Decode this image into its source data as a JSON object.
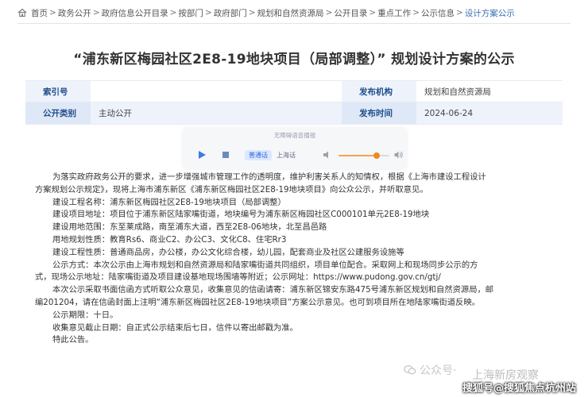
{
  "breadcrumb": {
    "items": [
      "首页",
      "政务公开",
      "政府信息公开目录",
      "按部门",
      "政府部门",
      "规划和自然资源局",
      "公开目录",
      "重点工作",
      "公示信息",
      "设计方案公示"
    ],
    "separator": ">"
  },
  "page_title": "“浦东新区梅园社区2E8-19地块项目（局部调整）” 规划设计方案的公示",
  "meta": {
    "index_label": "索引号",
    "index_value": "",
    "publisher_label": "发布机构",
    "publisher_value": "规划和自然资源局",
    "category_label": "公开类别",
    "category_value": "主动公开",
    "date_label": "发布时间",
    "date_value": "2024-06-24"
  },
  "player": {
    "label": "无障碍语音播报",
    "voice_selected": "普通话",
    "voice_option": "上海话",
    "volume_level": 0.75
  },
  "body": {
    "lines": [
      "为落实政府政务公开的要求，进一步增强城市管理工作的透明度，维护利害关系人的知情权，根据《上海市建设工程设计",
      "方案规划公示规定》，现将上海市浦东新区《浦东新区梅园社区2E8-19地块项目》向公众公示，并听取意见。",
      "建设工程名称：浦东新区梅园社区2E8-19地块项目（局部调整）",
      "建设项目地址：项目位于浦东新区陆家嘴街道，地块编号为浦东新区梅园社区C000101单元2E8-19地块",
      "建设用地范围：东至莱成路，南至浦东大道，西至2E8-06地块，北至昌邑路",
      "用地规划性质：教育Rs6、商业C2、办公C3、文化C8、住宅Rr3",
      "建设工程性质：普通商品房，办公楼，办公文化综合楼，幼儿园，配套商业及社区公建服务设施等",
      "公示方式：本次公示由上海市规划和自然资源局和陆家嘴街道共同组织，项目单位配合。采取网上和现场同步公示的方",
      "式，现场公示地址：陆家嘴街道及项目建设基地现场围墙等附近；公示网址：https://www.pudong.gov.cn/gtj/",
      "本次公示采取书面信函方式听取公众意见，收集意见的信函请寄：浦东新区锦安东路475号浦东新区规划和自然资源局，邮",
      "编201204，请在信函封面上注明“浦东新区梅园社区2E8-19地块项目”方案公示意见。也可到项目所在地陆家嘴街道反映。",
      "公示期限：十日。",
      "收集意见截止日期：自正式公示结束后七日，信件以寄出邮戳为准。",
      "特此公告。"
    ]
  },
  "watermarks": {
    "wm1": "公众号·",
    "wm2": "上海新房观察",
    "wm3": "搜狐号@搜狐焦点杭州站"
  },
  "colors": {
    "link_blue": "#3a6fb6",
    "label_blue": "#1f4e8c",
    "row_tint": "#eef3fb",
    "slider_orange": "#f08a1e"
  }
}
